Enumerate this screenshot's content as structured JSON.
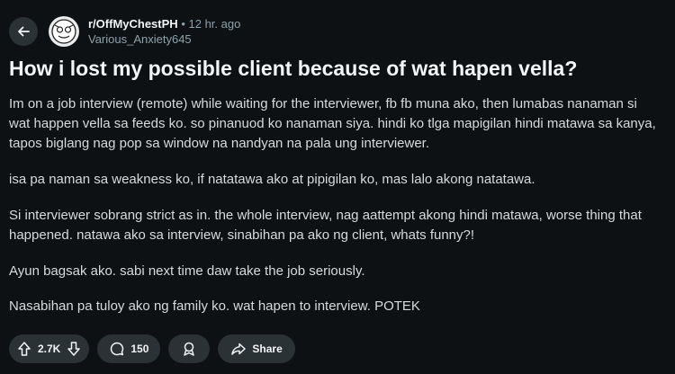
{
  "post": {
    "subreddit": "r/OffMyChestPH",
    "separator": "•",
    "time_ago": "12 hr. ago",
    "author": "Various_Anxiety645",
    "title": "How i lost my possible client because of wat hapen vella?",
    "paragraphs": [
      "Im on a job interview (remote) while waiting for the interviewer, fb fb muna ako, then lumabas nanaman si wat happen vella sa feeds ko. so pinanuod ko nanaman siya. hindi ko tlga mapigilan hindi matawa sa kanya, tapos biglang nag pop sa window na nandyan na pala ung interviewer.",
      "isa pa naman sa weakness ko, if natatawa ako at pipigilan ko, mas lalo akong natatawa.",
      "Si interviewer sobrang strict as in. the whole interview, nag aattempt akong hindi matawa, worse thing that happened. natawa ako sa interview, sinabihan pa ako ng client, whats funny?!",
      "Ayun bagsak ako. sabi next time daw take the job seriously.",
      "Nasabihan pa tuloy ako ng family ko. wat hapen to interview. POTEK"
    ]
  },
  "actions": {
    "vote_count": "2.7K",
    "comment_count": "150",
    "share_label": "Share"
  },
  "icons": {
    "back": "arrow-left",
    "avatar": "subreddit-avatar",
    "upvote": "arrow-up",
    "downvote": "arrow-down",
    "comment": "speech-bubble",
    "award": "award-ribbon",
    "share": "share-arrow"
  },
  "colors": {
    "background": "#0e1113",
    "pill": "#2a3236",
    "text": "#d7dadc",
    "muted": "#8ba2ad"
  }
}
